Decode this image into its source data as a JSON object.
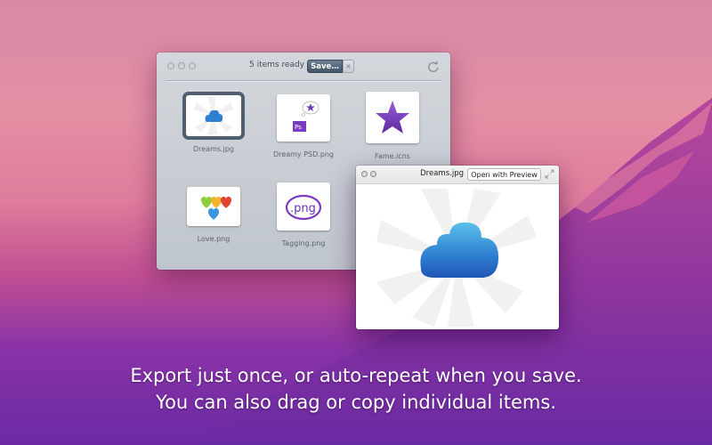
{
  "main_window": {
    "status": "5 items ready",
    "save_label": "Save…",
    "cancel_glyph": "×",
    "refresh_icon": "refresh-icon",
    "items": [
      {
        "label": "Dreams.jpg",
        "icon": "cloud-thumbnail",
        "selected": true
      },
      {
        "label": "Dreamy PSD.png",
        "icon": "psd-dream-thumbnail",
        "selected": false
      },
      {
        "label": "Fame.icns",
        "icon": "star-thumbnail",
        "selected": false
      },
      {
        "label": "Love.png",
        "icon": "hearts-thumbnail",
        "selected": false
      },
      {
        "label": "Tagging.png",
        "icon": "png-tag-thumbnail",
        "selected": false
      }
    ]
  },
  "preview_window": {
    "title": "Dreams.jpg",
    "open_button": "Open with Preview",
    "image": "cloud-image"
  },
  "caption": {
    "line1": "Export just once, or auto-repeat when you save.",
    "line2": "You can also drag or copy individual items."
  },
  "colors": {
    "save_button": "#4f6276",
    "cloud_blue": "#2f7fd0",
    "star_purple": "#7b3fbf"
  }
}
